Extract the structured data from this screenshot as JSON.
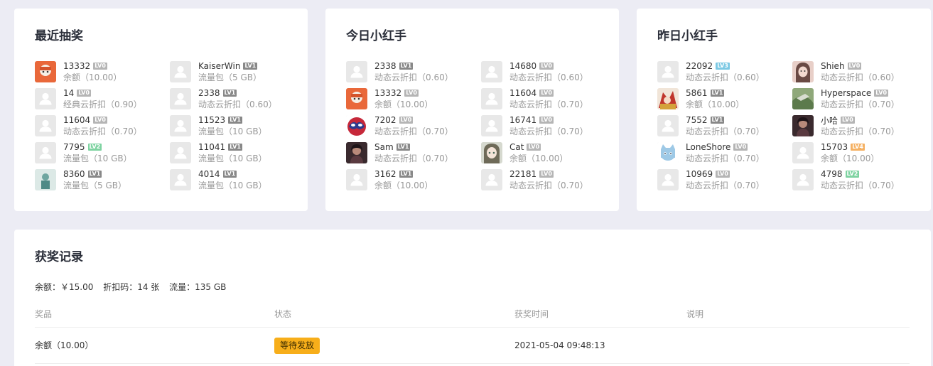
{
  "colors": {
    "lv0": "#b5b5b5",
    "lv1": "#888888",
    "lv2": "#7ed3a1",
    "lv3": "#7cc9e4",
    "lv4": "#f5b163",
    "badge": "#f7ae1a"
  },
  "recent": {
    "title": "最近抽奖",
    "users": [
      {
        "name": "13332",
        "lv": "LV0",
        "prize": "余额（10.00）",
        "avatar": "orange-avatar"
      },
      {
        "name": "KaiserWin",
        "lv": "LV1",
        "prize": "流量包（5 GB）",
        "avatar": "default-avatar"
      },
      {
        "name": "14",
        "lv": "LV0",
        "prize": "经典云折扣（0.90）",
        "avatar": "default-avatar"
      },
      {
        "name": "2338",
        "lv": "LV1",
        "prize": "动态云折扣（0.60）",
        "avatar": "default-avatar"
      },
      {
        "name": "11604",
        "lv": "LV0",
        "prize": "动态云折扣（0.70）",
        "avatar": "default-avatar"
      },
      {
        "name": "11523",
        "lv": "LV1",
        "prize": "流量包（10 GB）",
        "avatar": "default-avatar"
      },
      {
        "name": "7795",
        "lv": "LV2",
        "prize": "流量包（10 GB）",
        "avatar": "default-avatar"
      },
      {
        "name": "11041",
        "lv": "LV1",
        "prize": "流量包（10 GB）",
        "avatar": "default-avatar"
      },
      {
        "name": "8360",
        "lv": "LV1",
        "prize": "流量包（5 GB）",
        "avatar": "teal-avatar"
      },
      {
        "name": "4014",
        "lv": "LV1",
        "prize": "流量包（10 GB）",
        "avatar": "default-avatar"
      }
    ]
  },
  "today": {
    "title": "今日小红手",
    "users": [
      {
        "name": "2338",
        "lv": "LV1",
        "prize": "动态云折扣（0.60）",
        "avatar": "default-avatar"
      },
      {
        "name": "14680",
        "lv": "LV0",
        "prize": "动态云折扣（0.60）",
        "avatar": "default-avatar"
      },
      {
        "name": "13332",
        "lv": "LV0",
        "prize": "余额（10.00）",
        "avatar": "orange-avatar"
      },
      {
        "name": "11604",
        "lv": "LV0",
        "prize": "动态云折扣（0.70）",
        "avatar": "default-avatar"
      },
      {
        "name": "7202",
        "lv": "LV0",
        "prize": "动态云折扣（0.70）",
        "avatar": "spider-avatar"
      },
      {
        "name": "16741",
        "lv": "LV0",
        "prize": "动态云折扣（0.70）",
        "avatar": "default-avatar"
      },
      {
        "name": "Sam",
        "lv": "LV1",
        "prize": "动态云折扣（0.70）",
        "avatar": "dark-avatar"
      },
      {
        "name": "Cat",
        "lv": "LV0",
        "prize": "余额（10.00）",
        "avatar": "anime-avatar"
      },
      {
        "name": "3162",
        "lv": "LV1",
        "prize": "余额（10.00）",
        "avatar": "default-avatar"
      },
      {
        "name": "22181",
        "lv": "LV0",
        "prize": "动态云折扣（0.70）",
        "avatar": "default-avatar"
      }
    ]
  },
  "yesterday": {
    "title": "昨日小红手",
    "users": [
      {
        "name": "22092",
        "lv": "LV3",
        "prize": "动态云折扣（0.60）",
        "avatar": "default-avatar"
      },
      {
        "name": "Shieh",
        "lv": "LV0",
        "prize": "动态云折扣（0.60）",
        "avatar": "pink-avatar"
      },
      {
        "name": "5861",
        "lv": "LV1",
        "prize": "余额（10.00）",
        "avatar": "red-avatar"
      },
      {
        "name": "Hyperspace",
        "lv": "LV0",
        "prize": "动态云折扣（0.70）",
        "avatar": "green-avatar"
      },
      {
        "name": "7552",
        "lv": "LV1",
        "prize": "动态云折扣（0.70）",
        "avatar": "default-avatar"
      },
      {
        "name": "小哈",
        "lv": "LV0",
        "prize": "动态云折扣（0.70）",
        "avatar": "dark-avatar"
      },
      {
        "name": "LoneShore",
        "lv": "LV0",
        "prize": "动态云折扣（0.70）",
        "avatar": "blue-cat-avatar"
      },
      {
        "name": "15703",
        "lv": "LV4",
        "prize": "余额（10.00）",
        "avatar": "default-avatar"
      },
      {
        "name": "10969",
        "lv": "LV0",
        "prize": "动态云折扣（0.70）",
        "avatar": "default-avatar"
      },
      {
        "name": "4798",
        "lv": "LV2",
        "prize": "动态云折扣（0.70）",
        "avatar": "default-avatar"
      }
    ]
  },
  "records": {
    "title": "获奖记录",
    "balance": "余额：￥15.00",
    "coupons": "折扣码：14 张",
    "traffic": "流量：135 GB",
    "headers": {
      "prize": "奖品",
      "status": "状态",
      "time": "获奖时间",
      "note": "说明"
    },
    "rows": [
      {
        "prize": "余额（10.00）",
        "status": "等待发放",
        "time": "2021-05-04 09:48:13",
        "note": ""
      }
    ]
  }
}
